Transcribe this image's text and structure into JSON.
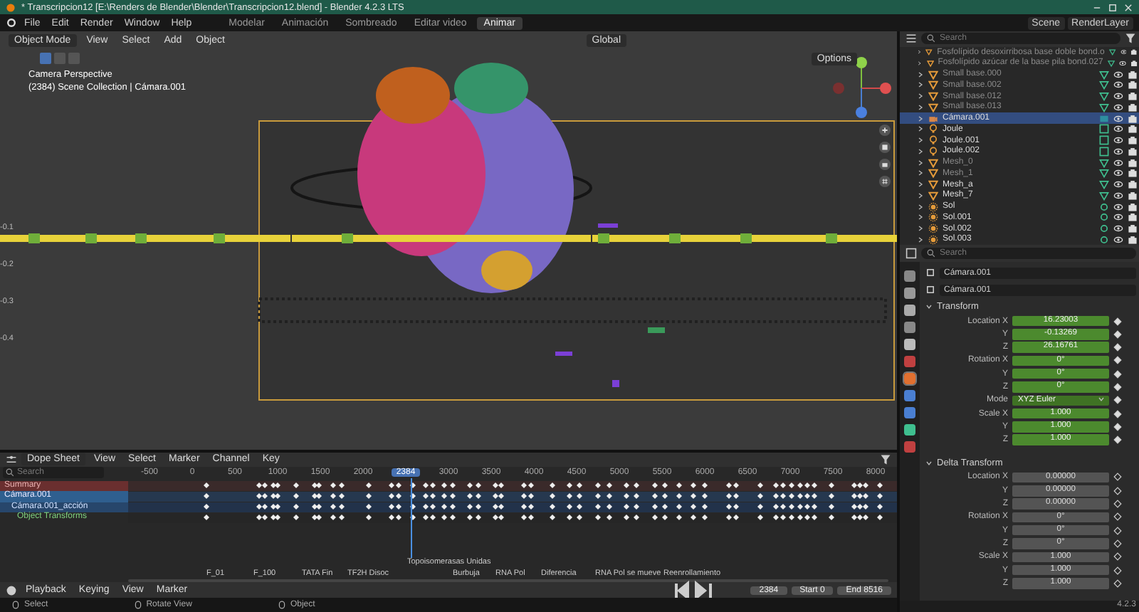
{
  "window": {
    "title": "* Transcripcion12 [E:\\Renders de Blender\\Blender\\Transcripcion12.blend] - Blender 4.2.3 LTS"
  },
  "menu": [
    "File",
    "Edit",
    "Render",
    "Window",
    "Help"
  ],
  "workspaces": [
    {
      "label": "Modelar",
      "selected": false
    },
    {
      "label": "Animación",
      "selected": false
    },
    {
      "label": "Sombreado",
      "selected": false
    },
    {
      "label": "Editar video",
      "selected": false
    },
    {
      "label": "Animar",
      "selected": true
    }
  ],
  "scene": "Scene",
  "view_layer": "RenderLayer",
  "viewport": {
    "mode": "Object Mode",
    "menus": [
      "View",
      "Select",
      "Add",
      "Object"
    ],
    "orientation": "Global",
    "options": "Options",
    "overlay_title": "Camera Perspective",
    "overlay_info": "(2384) Scene Collection | Cámara.001",
    "axis_labels": [
      "-0.1",
      "-0.2",
      "-0.3",
      "-0.4"
    ]
  },
  "outliner": {
    "search_placeholder": "Search",
    "items": [
      {
        "name": "Fosfolípido desoxirribosa base doble bond.o",
        "kind": "mesh",
        "selected": false,
        "dimmed": true
      },
      {
        "name": "Fosfolípido azúcar de la base pila bond.027",
        "kind": "mesh",
        "selected": false,
        "dimmed": true
      },
      {
        "name": "Small base.000",
        "kind": "mesh",
        "selected": false,
        "dimmed": true
      },
      {
        "name": "Small base.002",
        "kind": "mesh",
        "selected": false,
        "dimmed": true
      },
      {
        "name": "Small base.012",
        "kind": "mesh",
        "selected": false,
        "dimmed": true
      },
      {
        "name": "Small base.013",
        "kind": "mesh",
        "selected": false,
        "dimmed": true
      },
      {
        "name": "Cámara.001",
        "kind": "camera",
        "selected": true,
        "dimmed": false
      },
      {
        "name": "Joule",
        "kind": "light",
        "selected": false,
        "dimmed": false
      },
      {
        "name": "Joule.001",
        "kind": "light",
        "selected": false,
        "dimmed": false
      },
      {
        "name": "Joule.002",
        "kind": "light",
        "selected": false,
        "dimmed": false
      },
      {
        "name": "Mesh_0",
        "kind": "mesh",
        "selected": false,
        "dimmed": true
      },
      {
        "name": "Mesh_1",
        "kind": "mesh",
        "selected": false,
        "dimmed": true
      },
      {
        "name": "Mesh_a",
        "kind": "mesh",
        "selected": false,
        "dimmed": false
      },
      {
        "name": "Mesh_7",
        "kind": "mesh",
        "selected": false,
        "dimmed": false
      },
      {
        "name": "Sol",
        "kind": "sun",
        "selected": false,
        "dimmed": false
      },
      {
        "name": "Sol.001",
        "kind": "sun",
        "selected": false,
        "dimmed": false
      },
      {
        "name": "Sol.002",
        "kind": "sun",
        "selected": false,
        "dimmed": false
      },
      {
        "name": "Sol.003",
        "kind": "sun",
        "selected": false,
        "dimmed": false
      }
    ]
  },
  "properties": {
    "search_placeholder": "Search",
    "object": "Cámara.001",
    "data": "Cámara.001",
    "sections": [
      {
        "title": "Transform",
        "expanded": true,
        "animated": true,
        "fields": [
          {
            "label": "Location X",
            "value": "16.23003",
            "kind": "number"
          },
          {
            "label": "Y",
            "value": "-0.13269",
            "kind": "number"
          },
          {
            "label": "Z",
            "value": "26.16761",
            "kind": "number"
          },
          {
            "label": "Rotation X",
            "value": "0°",
            "kind": "number"
          },
          {
            "label": "Y",
            "value": "0°",
            "kind": "number"
          },
          {
            "label": "Z",
            "value": "0°",
            "kind": "number"
          },
          {
            "label": "Mode",
            "value": "XYZ Euler",
            "kind": "dropdown"
          },
          {
            "label": "Scale X",
            "value": "1.000",
            "kind": "number"
          },
          {
            "label": "Y",
            "value": "1.000",
            "kind": "number"
          },
          {
            "label": "Z",
            "value": "1.000",
            "kind": "number"
          }
        ]
      },
      {
        "title": "Delta Transform",
        "expanded": true,
        "animated": false,
        "fields": [
          {
            "label": "Location X",
            "value": "0.00000",
            "kind": "number"
          },
          {
            "label": "Y",
            "value": "0.00000",
            "kind": "number"
          },
          {
            "label": "Z",
            "value": "0.00000",
            "kind": "number"
          },
          {
            "label": "Rotation X",
            "value": "0°",
            "kind": "number"
          },
          {
            "label": "Y",
            "value": "0°",
            "kind": "number"
          },
          {
            "label": "Z",
            "value": "0°",
            "kind": "number"
          },
          {
            "label": "Scale X",
            "value": "1.000",
            "kind": "number"
          },
          {
            "label": "Y",
            "value": "1.000",
            "kind": "number"
          },
          {
            "label": "Z",
            "value": "1.000",
            "kind": "number"
          }
        ]
      }
    ],
    "version": "4.2.3"
  },
  "dopesheet": {
    "editor": "Dope Sheet",
    "menus": [
      "View",
      "Select",
      "Marker",
      "Channel",
      "Key"
    ],
    "search_placeholder": "Search",
    "frames": [
      {
        "label": "-500",
        "selected": false
      },
      {
        "label": "0",
        "selected": false
      },
      {
        "label": "500",
        "selected": false
      },
      {
        "label": "1000",
        "selected": false
      },
      {
        "label": "1500",
        "selected": false
      },
      {
        "label": "2000",
        "selected": false
      },
      {
        "label": "2384",
        "selected": true
      },
      {
        "label": "3000",
        "selected": false
      },
      {
        "label": "3500",
        "selected": false
      },
      {
        "label": "4000",
        "selected": false
      },
      {
        "label": "4500",
        "selected": false
      },
      {
        "label": "5000",
        "selected": false
      },
      {
        "label": "5500",
        "selected": false
      },
      {
        "label": "6000",
        "selected": false
      },
      {
        "label": "6500",
        "selected": false
      },
      {
        "label": "7000",
        "selected": false
      },
      {
        "label": "7500",
        "selected": false
      },
      {
        "label": "8000",
        "selected": false
      }
    ],
    "channels": [
      {
        "name": "Summary",
        "kind": "summary"
      },
      {
        "name": "Cámara.001",
        "kind": "object"
      },
      {
        "name": "Cámara.001_acción",
        "kind": "action"
      },
      {
        "name": "Object Transforms",
        "kind": "group"
      }
    ],
    "markers": [
      {
        "label": "F_01",
        "kind": "lower"
      },
      {
        "label": "F_100",
        "kind": "lower"
      },
      {
        "label": "TATA Fin",
        "kind": "lower"
      },
      {
        "label": "TF2H Disoc",
        "kind": "lower"
      },
      {
        "label": "Topoisomerasas Unidas",
        "kind": "upper"
      },
      {
        "label": "Burbuja",
        "kind": "lower"
      },
      {
        "label": "RNA Pol",
        "kind": "lower"
      },
      {
        "label": "Diferencia",
        "kind": "lower"
      },
      {
        "label": "RNA Pol se mueve",
        "kind": "lower"
      },
      {
        "label": "Reenrollamiento",
        "kind": "lower"
      }
    ],
    "footer_menus": [
      "Playback",
      "Keying",
      "View",
      "Marker"
    ],
    "current_frame": "2384",
    "start_label": "Start",
    "start": "0",
    "end_label": "End",
    "end": "8516"
  },
  "status_bar": [
    "Select",
    "Rotate View",
    "Object"
  ]
}
